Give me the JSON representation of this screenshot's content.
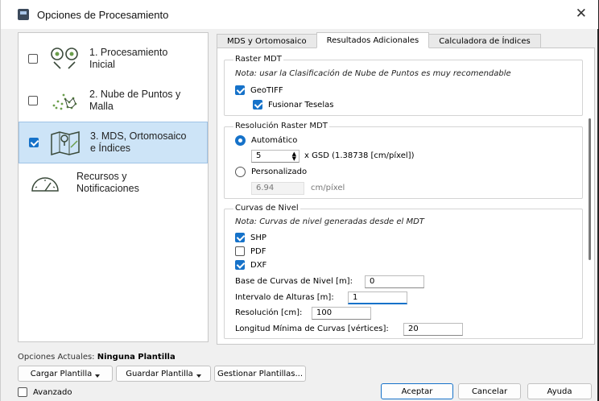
{
  "window": {
    "title": "Opciones de Procesamiento",
    "close_glyph": "✕"
  },
  "sidebar": {
    "items": [
      {
        "label_line1": "1. Procesamiento",
        "label_line2": "Inicial",
        "checked": false,
        "icon": "initial-processing-icon"
      },
      {
        "label_line1": "2. Nube de Puntos y",
        "label_line2": "Malla",
        "checked": false,
        "icon": "point-cloud-icon"
      },
      {
        "label_line1": "3. MDS, Ortomosaico",
        "label_line2": "e Índices",
        "checked": true,
        "icon": "dsm-map-icon"
      },
      {
        "label_line1": "Recursos y",
        "label_line2": "Notificaciones",
        "icon": "gauge-icon"
      }
    ]
  },
  "tabs": [
    {
      "label": "MDS y Ortomosaico",
      "active": false
    },
    {
      "label": "Resultados Adicionales",
      "active": true
    },
    {
      "label": "Calculadora de Índices",
      "active": false
    }
  ],
  "raster_mdt": {
    "title": "Raster MDT",
    "note": "Nota: usar la Clasificación de Nube de Puntos es muy recomendable",
    "geotiff_label": "GeoTIFF",
    "merge_label": "Fusionar Teselas"
  },
  "resolution": {
    "title": "Resolución Raster MDT",
    "auto_label": "Automático",
    "auto_value": "5",
    "gsd_text": "x GSD (1.38738 [cm/píxel])",
    "custom_label": "Personalizado",
    "custom_value": "6.94",
    "custom_unit": "cm/píxel"
  },
  "contours": {
    "title": "Curvas de Nivel",
    "note": "Nota: Curvas de nivel generadas desde el MDT",
    "shp": "SHP",
    "pdf": "PDF",
    "dxf": "DXF",
    "base_label": "Base de Curvas de Nivel [m]:",
    "base_value": "0",
    "interval_label": "Intervalo de Alturas [m]:",
    "interval_value": "1",
    "resolution_label": "Resolución [cm]:",
    "resolution_value": "100",
    "min_length_label": "Longitud Mínima de Curvas [vértices]:",
    "min_length_value": "20"
  },
  "footer": {
    "current_label": "Opciones Actuales:",
    "current_value": "Ninguna Plantilla",
    "load_template": "Cargar Plantilla",
    "save_template": "Guardar Plantilla",
    "manage_templates": "Gestionar Plantillas...",
    "advanced": "Avanzado",
    "accept": "Aceptar",
    "cancel": "Cancelar",
    "help": "Ayuda"
  },
  "colors": {
    "accent": "#1672c9",
    "selection": "#cde4f7"
  }
}
